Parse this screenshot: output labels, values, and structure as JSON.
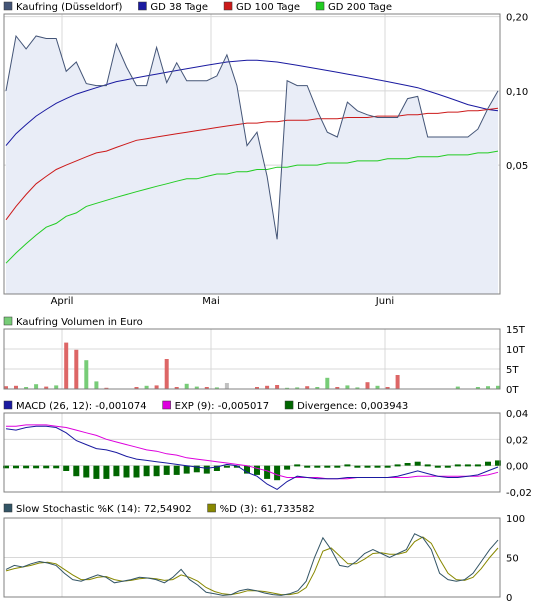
{
  "chart_data": [
    {
      "type": "line",
      "panel": "price",
      "series": [
        {
          "name": "Kaufring (Düsseldorf)",
          "color": "#445577",
          "fill": "#e9edf7",
          "values": [
            0.1,
            0.167,
            0.148,
            0.167,
            0.163,
            0.163,
            0.12,
            0.131,
            0.107,
            0.105,
            0.105,
            0.155,
            0.125,
            0.105,
            0.105,
            0.15,
            0.108,
            0.13,
            0.11,
            0.11,
            0.11,
            0.115,
            0.14,
            0.105,
            0.06,
            0.068,
            0.045,
            0.025,
            0.11,
            0.105,
            0.105,
            0.083,
            0.068,
            0.065,
            0.09,
            0.083,
            0.08,
            0.078,
            0.078,
            0.078,
            0.093,
            0.095,
            0.065,
            0.065,
            0.065,
            0.065,
            0.065,
            0.07,
            0.085,
            0.1
          ]
        },
        {
          "name": "GD 38 Tage",
          "color": "#1a1aa0",
          "values": [
            0.06,
            0.067,
            0.073,
            0.079,
            0.084,
            0.089,
            0.093,
            0.097,
            0.1,
            0.103,
            0.106,
            0.109,
            0.111,
            0.113,
            0.115,
            0.117,
            0.119,
            0.121,
            0.123,
            0.125,
            0.127,
            0.129,
            0.131,
            0.132,
            0.133,
            0.133,
            0.132,
            0.131,
            0.129,
            0.127,
            0.125,
            0.123,
            0.121,
            0.119,
            0.117,
            0.115,
            0.113,
            0.111,
            0.109,
            0.107,
            0.105,
            0.103,
            0.1,
            0.097,
            0.094,
            0.091,
            0.088,
            0.086,
            0.084,
            0.083
          ]
        },
        {
          "name": "GD 100 Tage",
          "color": "#cc1a1a",
          "values": [
            0.03,
            0.034,
            0.038,
            0.042,
            0.045,
            0.048,
            0.05,
            0.052,
            0.054,
            0.056,
            0.057,
            0.059,
            0.061,
            0.063,
            0.064,
            0.065,
            0.066,
            0.067,
            0.068,
            0.069,
            0.07,
            0.071,
            0.072,
            0.073,
            0.074,
            0.074,
            0.075,
            0.075,
            0.076,
            0.076,
            0.076,
            0.077,
            0.077,
            0.077,
            0.078,
            0.078,
            0.078,
            0.079,
            0.079,
            0.079,
            0.08,
            0.08,
            0.081,
            0.081,
            0.082,
            0.082,
            0.083,
            0.083,
            0.084,
            0.085
          ]
        },
        {
          "name": "GD 200 Tage",
          "color": "#22cc22",
          "values": [
            0.02,
            0.022,
            0.024,
            0.026,
            0.028,
            0.029,
            0.031,
            0.032,
            0.034,
            0.035,
            0.036,
            0.037,
            0.038,
            0.039,
            0.04,
            0.041,
            0.042,
            0.043,
            0.044,
            0.044,
            0.045,
            0.046,
            0.046,
            0.047,
            0.047,
            0.048,
            0.048,
            0.049,
            0.049,
            0.05,
            0.05,
            0.05,
            0.051,
            0.051,
            0.051,
            0.052,
            0.052,
            0.052,
            0.053,
            0.053,
            0.053,
            0.054,
            0.054,
            0.054,
            0.055,
            0.055,
            0.055,
            0.056,
            0.056,
            0.057
          ]
        }
      ],
      "x_ticks": [
        "April",
        "Mai",
        "Juni"
      ],
      "y_ticks": [
        "0,20",
        "0,10",
        "0,05"
      ],
      "y_tick_values": [
        0.2,
        0.1,
        0.05
      ],
      "ylim": [
        0.015,
        0.205
      ],
      "scale": "log"
    },
    {
      "type": "bar",
      "panel": "volume",
      "series": [
        {
          "name": "Kaufring Volumen in Euro",
          "color": "#77cc77",
          "values": [
            0.7,
            0.8,
            0.5,
            1.2,
            0.6,
            0.9,
            11.6,
            9.8,
            7.2,
            1.9,
            0.3,
            0.0,
            0.0,
            0.5,
            0.8,
            0.9,
            7.5,
            0.5,
            1.3,
            0.6,
            0.5,
            0.4,
            1.5,
            0.0,
            0.0,
            0.5,
            0.8,
            1.0,
            0.3,
            0.4,
            0.7,
            0.5,
            2.8,
            0.5,
            0.9,
            0.4,
            1.7,
            0.8,
            0.5,
            3.5,
            0.0,
            0.0,
            0.0,
            0.0,
            0.0,
            0.6,
            0.0,
            0.5,
            0.7,
            0.8
          ],
          "colors": [
            "#dd6666",
            "#dd6666",
            "#77cc77",
            "#77cc77",
            "#dd6666",
            "#77cc77",
            "#dd6666",
            "#dd6666",
            "#77cc77",
            "#77cc77",
            "#dd6666",
            "#dd6666",
            "#dd6666",
            "#dd6666",
            "#77cc77",
            "#dd6666",
            "#dd6666",
            "#dd6666",
            "#77cc77",
            "#77cc77",
            "#dd6666",
            "#77cc77",
            "#c0c0c0",
            "#dd6666",
            "#dd6666",
            "#dd6666",
            "#dd6666",
            "#dd6666",
            "#77cc77",
            "#77cc77",
            "#dd6666",
            "#77cc77",
            "#77cc77",
            "#dd6666",
            "#77cc77",
            "#77cc77",
            "#dd6666",
            "#77cc77",
            "#dd6666",
            "#dd6666",
            "#dd6666",
            "#dd6666",
            "#dd6666",
            "#dd6666",
            "#dd6666",
            "#77cc77",
            "#77cc77",
            "#77cc77",
            "#77cc77",
            "#77cc77"
          ]
        }
      ],
      "y_ticks": [
        "15T",
        "10T",
        "5T",
        "0T"
      ],
      "y_tick_values": [
        15,
        10,
        5,
        0
      ],
      "ylim": [
        0,
        15
      ]
    },
    {
      "type": "line",
      "panel": "macd",
      "series": [
        {
          "name": "MACD (26, 12): -0,001074",
          "color": "#1a1aa0",
          "values": [
            0.028,
            0.027,
            0.029,
            0.03,
            0.03,
            0.029,
            0.025,
            0.019,
            0.016,
            0.013,
            0.012,
            0.01,
            0.007,
            0.005,
            0.004,
            0.003,
            0.002,
            0.001,
            0.0,
            -0.001,
            -0.002,
            -0.001,
            0.001,
            0.0,
            -0.005,
            -0.008,
            -0.014,
            -0.018,
            -0.012,
            -0.008,
            -0.009,
            -0.01,
            -0.01,
            -0.01,
            -0.009,
            -0.009,
            -0.009,
            -0.009,
            -0.009,
            -0.008,
            -0.006,
            -0.004,
            -0.006,
            -0.008,
            -0.009,
            -0.009,
            -0.008,
            -0.007,
            -0.004,
            -0.001
          ]
        },
        {
          "name": "EXP (9): -0,005017",
          "color": "#dd00dd",
          "values": [
            0.03,
            0.03,
            0.031,
            0.031,
            0.031,
            0.03,
            0.029,
            0.027,
            0.025,
            0.023,
            0.02,
            0.018,
            0.016,
            0.014,
            0.012,
            0.011,
            0.009,
            0.008,
            0.006,
            0.005,
            0.004,
            0.003,
            0.002,
            0.001,
            0.0,
            -0.002,
            -0.004,
            -0.007,
            -0.009,
            -0.009,
            -0.009,
            -0.009,
            -0.01,
            -0.01,
            -0.01,
            -0.009,
            -0.009,
            -0.009,
            -0.009,
            -0.009,
            -0.009,
            -0.008,
            -0.008,
            -0.008,
            -0.008,
            -0.008,
            -0.008,
            -0.008,
            -0.007,
            -0.005
          ]
        },
        {
          "name": "Divergence: 0,003943",
          "color": "#006600",
          "type": "bar",
          "values": [
            -0.002,
            -0.002,
            -0.002,
            -0.002,
            -0.002,
            -0.002,
            -0.004,
            -0.008,
            -0.009,
            -0.01,
            -0.01,
            -0.008,
            -0.009,
            -0.009,
            -0.008,
            -0.008,
            -0.007,
            -0.007,
            -0.006,
            -0.005,
            -0.006,
            -0.004,
            -0.001,
            -0.001,
            -0.006,
            -0.007,
            -0.01,
            -0.011,
            -0.003,
            0.001,
            0.0,
            -0.001,
            -0.001,
            0.0,
            0.001,
            0.0,
            0.0,
            0.0,
            0.0,
            0.001,
            0.002,
            0.003,
            0.001,
            0.0,
            0.0,
            0.001,
            0.001,
            0.001,
            0.003,
            0.004
          ]
        }
      ],
      "y_ticks": [
        "0,04",
        "0,02",
        "0,00",
        "-0,02"
      ],
      "y_tick_values": [
        0.04,
        0.02,
        0.0,
        -0.02
      ],
      "ylim": [
        -0.02,
        0.04
      ]
    },
    {
      "type": "line",
      "panel": "stochastic",
      "series": [
        {
          "name": "Slow Stochastic %K (14): 72,54902",
          "color": "#335566",
          "values": [
            35,
            40,
            38,
            42,
            45,
            43,
            40,
            30,
            22,
            20,
            24,
            28,
            25,
            18,
            20,
            22,
            25,
            24,
            22,
            18,
            25,
            35,
            22,
            15,
            6,
            4,
            2,
            3,
            8,
            10,
            8,
            5,
            3,
            2,
            4,
            8,
            20,
            50,
            75,
            60,
            40,
            38,
            45,
            55,
            60,
            55,
            50,
            55,
            60,
            80,
            75,
            60,
            30,
            22,
            20,
            22,
            30,
            45,
            60,
            72
          ]
        },
        {
          "name": "%D (3): 61,733582",
          "color": "#888800",
          "values": [
            33,
            36,
            38,
            40,
            43,
            44,
            42,
            35,
            28,
            22,
            22,
            25,
            26,
            22,
            20,
            21,
            23,
            24,
            23,
            21,
            22,
            28,
            25,
            20,
            12,
            7,
            4,
            3,
            5,
            8,
            8,
            7,
            5,
            3,
            3,
            5,
            12,
            32,
            58,
            62,
            52,
            42,
            42,
            48,
            55,
            56,
            54,
            54,
            57,
            70,
            76,
            68,
            48,
            30,
            22,
            21,
            25,
            36,
            50,
            62
          ]
        }
      ],
      "y_ticks": [
        "100",
        "50",
        "0"
      ],
      "y_tick_values": [
        100,
        50,
        0
      ],
      "ylim": [
        0,
        100
      ]
    }
  ]
}
